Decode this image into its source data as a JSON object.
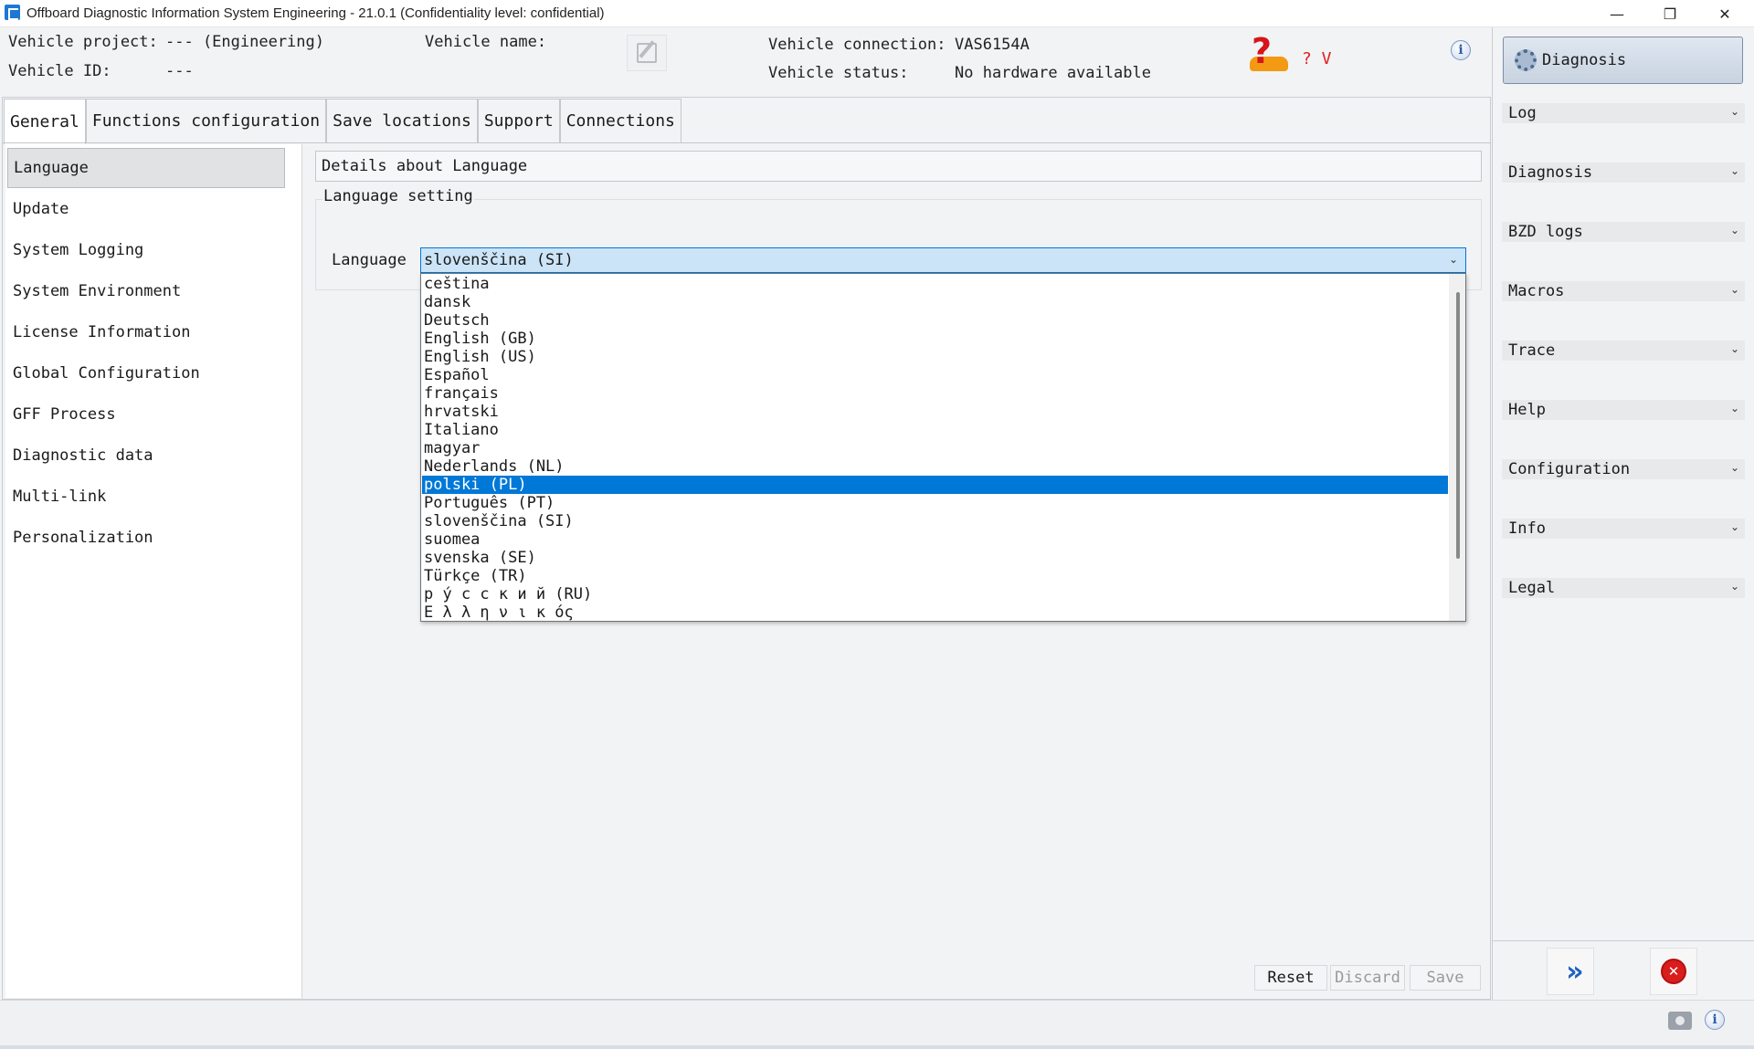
{
  "window": {
    "title": "Offboard Diagnostic Information System Engineering - 21.0.1 (Confidentiality level: confidential)",
    "minimize_glyph": "—",
    "restore_glyph": "❐",
    "close_glyph": "✕"
  },
  "header": {
    "vehicle_project_label": "Vehicle project:",
    "vehicle_project_value": "---  (Engineering)",
    "vehicle_id_label": "Vehicle ID:",
    "vehicle_id_value": "---",
    "vehicle_name_label": "Vehicle name:",
    "vehicle_connection_label": "Vehicle connection:",
    "vehicle_connection_value": "VAS6154A",
    "vehicle_status_label": "Vehicle status:",
    "vehicle_status_value": "No hardware available",
    "status_indicator": "? V",
    "info_glyph": "i"
  },
  "tabs": [
    {
      "label": "General",
      "active": true
    },
    {
      "label": "Functions configuration",
      "active": false
    },
    {
      "label": "Save locations",
      "active": false
    },
    {
      "label": "Support",
      "active": false
    },
    {
      "label": "Connections",
      "active": false
    }
  ],
  "sidebar": {
    "items": [
      {
        "label": "Language",
        "active": true
      },
      {
        "label": "Update"
      },
      {
        "label": "System Logging"
      },
      {
        "label": "System Environment"
      },
      {
        "label": "License Information"
      },
      {
        "label": "Global Configuration"
      },
      {
        "label": "GFF Process"
      },
      {
        "label": "Diagnostic data"
      },
      {
        "label": "Multi-link"
      },
      {
        "label": "Personalization"
      }
    ]
  },
  "details": {
    "title": "Details about Language",
    "group_title": "Language setting",
    "language_label": "Language",
    "selected_value": "slovenščina (SI)",
    "chevron_glyph": "⌄"
  },
  "dropdown": {
    "options": [
      "ceština",
      "dansk",
      "Deutsch",
      "English (GB)",
      "English (US)",
      "Español",
      "français",
      "hrvatski",
      "Italiano",
      "magyar",
      "Nederlands (NL)",
      "polski (PL)",
      "Português (PT)",
      "slovenščina (SI)",
      "suomea",
      "svenska (SE)",
      "Türkçe (TR)",
      "р у́ с с к и й  (RU)",
      "Ε λ λ η ν ι κ ός"
    ],
    "highlighted_index": 11
  },
  "footer_buttons": {
    "reset": "Reset",
    "discard": "Discard",
    "save": "Save"
  },
  "right_panel": {
    "diagnosis_button": "Diagnosis",
    "chevron_glyph": "⌄",
    "sections": [
      "Log",
      "Diagnosis",
      "BZD logs",
      "Macros",
      "Trace",
      "Help",
      "Configuration",
      "Info",
      "Legal"
    ],
    "forward_glyph": "»",
    "close_glyph": "✕"
  },
  "statusbar": {
    "info_glyph": "i"
  }
}
